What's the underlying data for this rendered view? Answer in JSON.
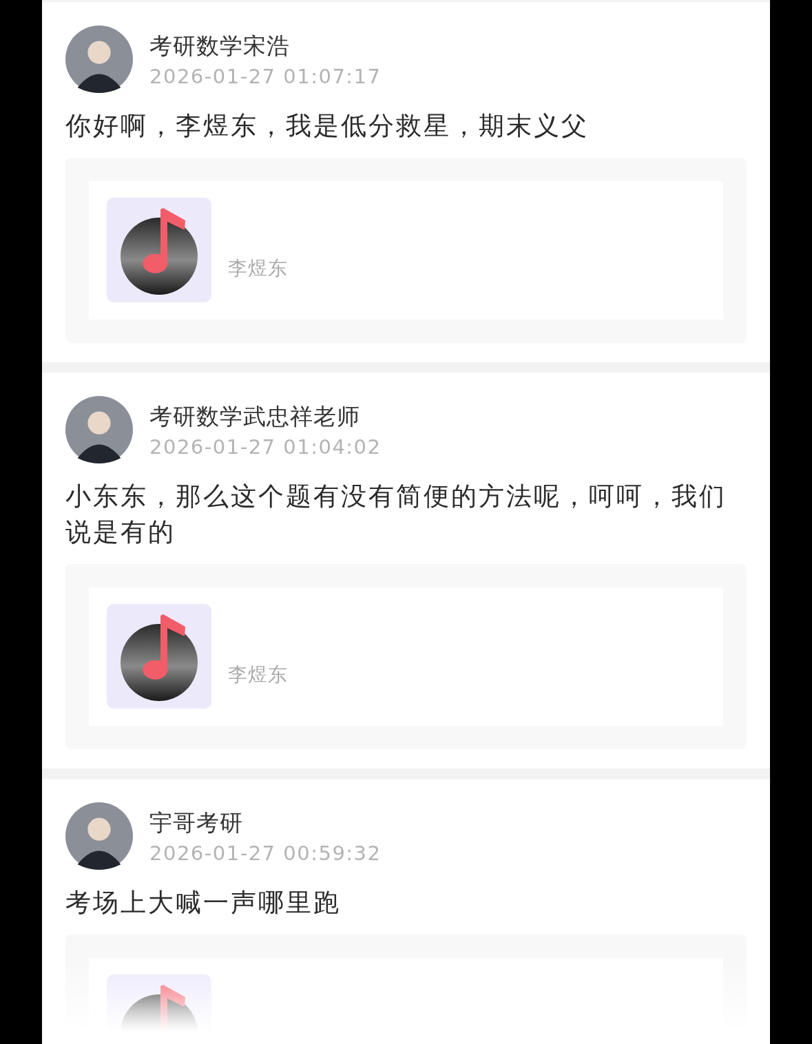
{
  "posts": [
    {
      "author": "考研数学宋浩",
      "time": "2026-01-27 01:07:17",
      "text": "你好啊，李煜东，我是低分救星，期末义父",
      "attachment": {
        "kind": "music",
        "label": "李煜东"
      }
    },
    {
      "author": "考研数学武忠祥老师",
      "time": "2026-01-27 01:04:02",
      "text": "小东东，那么这个题有没有简便的方法呢，呵呵，我们说是有的",
      "attachment": {
        "kind": "music",
        "label": "李煜东"
      }
    },
    {
      "author": "宇哥考研",
      "time": "2026-01-27 00:59:32",
      "text": "考场上大喊一声哪里跑",
      "attachment": {
        "kind": "music"
      }
    }
  ]
}
